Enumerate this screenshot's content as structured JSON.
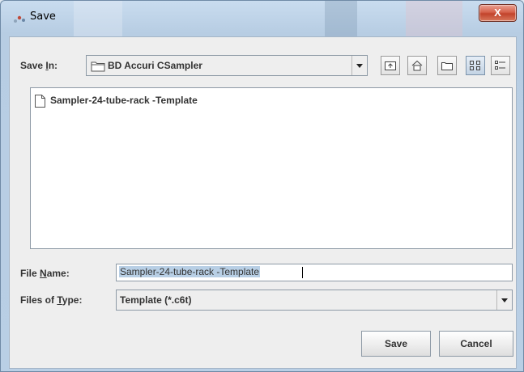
{
  "window": {
    "title": "Save",
    "close_label": "X"
  },
  "save_in": {
    "label_pre": "Save ",
    "label_mnemonic": "I",
    "label_post": "n:",
    "value": "BD Accuri CSampler"
  },
  "toolbar": {
    "buttons": [
      {
        "name": "up-one-level-button",
        "icon": "folder-up-icon"
      },
      {
        "name": "home-button",
        "icon": "home-icon"
      },
      {
        "name": "new-folder-button",
        "icon": "new-folder-icon"
      },
      {
        "name": "list-view-button",
        "icon": "list-view-icon",
        "active": true
      },
      {
        "name": "details-view-button",
        "icon": "details-view-icon"
      }
    ]
  },
  "files": [
    {
      "name": "Sampler-24-tube-rack -Template",
      "icon": "document-icon"
    }
  ],
  "file_name": {
    "label_pre": "File ",
    "label_mnemonic": "N",
    "label_post": "ame:",
    "value": "Sampler-24-tube-rack -Template"
  },
  "file_type": {
    "label_pre": "Files of ",
    "label_mnemonic": "T",
    "label_post": "ype:",
    "value": "Template (*.c6t)"
  },
  "buttons": {
    "save": "Save",
    "cancel": "Cancel"
  },
  "colors": {
    "selection": "#b8cfe5",
    "close_button": "#c2432b"
  }
}
